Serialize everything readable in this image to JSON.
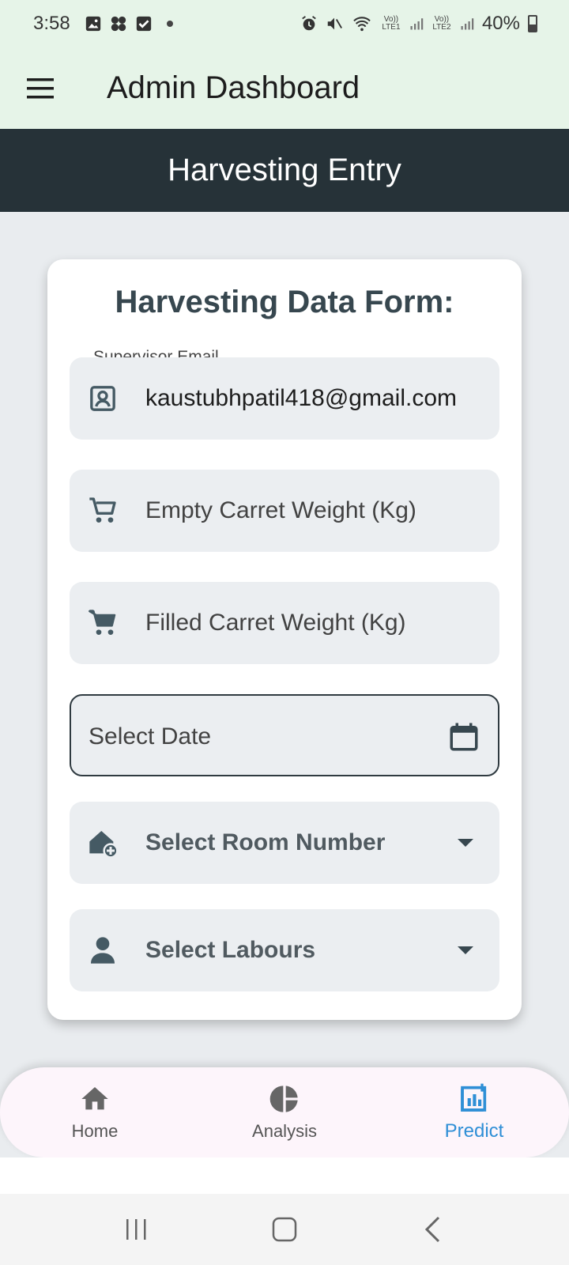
{
  "status_bar": {
    "time": "3:58",
    "battery": "40%",
    "sim1": "Vo)) LTE1",
    "sim2": "Vo)) LTE2",
    "icons": [
      "image-icon",
      "fan-icon",
      "checkbox-icon",
      "dot-icon",
      "alarm-icon",
      "mute-icon",
      "wifi-icon",
      "signal-icon",
      "battery-icon"
    ]
  },
  "app_bar": {
    "title": "Admin Dashboard",
    "menu_icon": "menu-icon"
  },
  "banner": {
    "title": "Harvesting Entry"
  },
  "form": {
    "title": "Harvesting Data Form:",
    "supervisor_email": {
      "label": "Supervisor Email",
      "value": "kaustubhpatil418@gmail.com",
      "icon": "contact-icon"
    },
    "empty_weight": {
      "placeholder": "Empty Carret Weight (Kg)",
      "icon": "cart-outline-icon"
    },
    "filled_weight": {
      "placeholder": "Filled Carret Weight (Kg)",
      "icon": "cart-filled-icon"
    },
    "date": {
      "placeholder": "Select Date",
      "icon": "calendar-icon"
    },
    "room": {
      "placeholder": "Select Room Number",
      "icon": "add-home-icon"
    },
    "labours": {
      "placeholder": "Select Labours",
      "icon": "person-icon"
    }
  },
  "bottom_nav": {
    "items": [
      {
        "label": "Home",
        "icon": "home-icon",
        "active": false
      },
      {
        "label": "Analysis",
        "icon": "pie-chart-icon",
        "active": false
      },
      {
        "label": "Predict",
        "icon": "insights-icon",
        "active": true
      }
    ]
  },
  "colors": {
    "app_bar_bg": "#e6f4e8",
    "banner_bg": "#263238",
    "accent": "#2f8fd6",
    "field_bg": "#ebeef1",
    "nav_bg": "#fdf5fb"
  }
}
